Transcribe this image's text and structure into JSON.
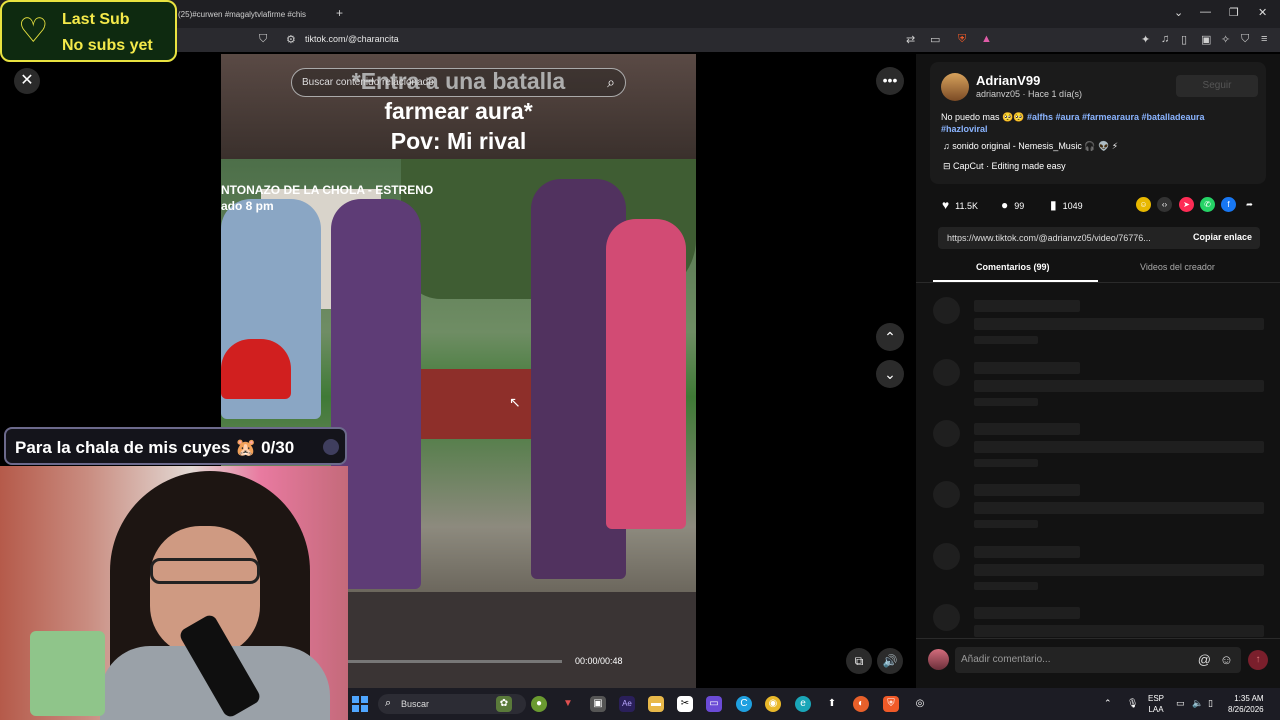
{
  "browser": {
    "tab_title": "(25)#curwen #magalytvlafirme #chis",
    "url": "tiktok.com/@charancita",
    "new_tab": "+",
    "window_controls": [
      "⌄",
      "—",
      "❐",
      "✕"
    ]
  },
  "overlays": {
    "last_sub_line1": "Last Sub",
    "last_sub_line2": "No subs yet",
    "sub_goal": "Para la chala de mis cuyes 🐹 0/30"
  },
  "video": {
    "search_placeholder": "Buscar contenido relacionado",
    "caption_line1": "*Entra a una batalla",
    "caption_line2": "farmear aura*",
    "caption_line3": "Pov: Mi rival",
    "scene_text_1": "NTONAZO DE LA CHOLA - ESTRENO",
    "scene_text_2": "ado 8 pm",
    "time": "00:00/00:48",
    "progress": 0.0
  },
  "creator": {
    "name": "AdrianV99",
    "handle_time": "adrianvz05 · Hace 1 día(s)",
    "follow_label": "Seguir",
    "desc_text": "No puedo mas 🥺🥺",
    "desc_tags": "#alfhs #aura #farmearaura #batalladeaura #hazloviral",
    "music": "sonido original - Nemesis_Music 🎧 👽 ⚡",
    "capcut": "CapCut · Editing made easy"
  },
  "stats": {
    "likes": "11.5K",
    "comments": "99",
    "saves": "1049"
  },
  "link": {
    "url": "https://www.tiktok.com/@adrianvz05/video/76776...",
    "copy_label": "Copiar enlace"
  },
  "panel_tabs": {
    "comments": "Comentarios (99)",
    "creator_videos": "Videos del creador"
  },
  "comment_input": {
    "placeholder": "Añadir comentario...",
    "at": "@",
    "emoji": "☺"
  },
  "taskbar": {
    "search": "Buscar",
    "lang_line1": "ESP",
    "lang_line2": "LAA",
    "time": "1:35 AM",
    "date": "8/26/2026"
  },
  "colors": {
    "accent_yellow": "#e9e340",
    "tiktok_red": "#fe2c55",
    "link_blue": "#8ab4ff"
  }
}
